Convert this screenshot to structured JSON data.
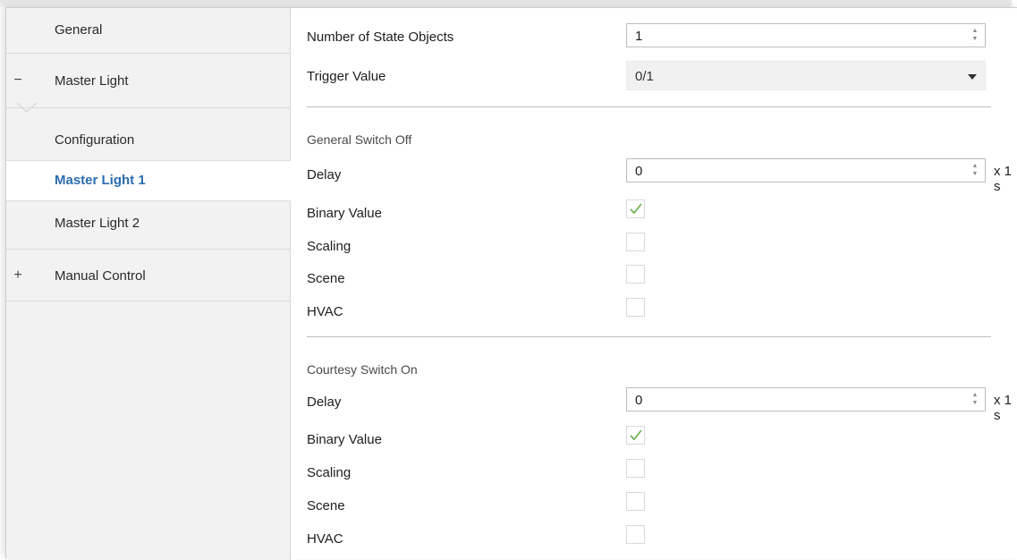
{
  "sidebar": {
    "items": [
      {
        "label": "General",
        "sign": ""
      },
      {
        "label": "Master Light",
        "sign": "−"
      },
      {
        "label": "Configuration",
        "sign": ""
      },
      {
        "label": "Master Light 1",
        "sign": "",
        "selected": true
      },
      {
        "label": "Master Light 2",
        "sign": ""
      },
      {
        "label": "Manual Control",
        "sign": "+"
      }
    ]
  },
  "main": {
    "number_of_state_objects": {
      "label": "Number of State Objects",
      "value": "1"
    },
    "trigger_value": {
      "label": "Trigger Value",
      "value": "0/1"
    },
    "general_switch_off": {
      "title": "General Switch Off",
      "delay": {
        "label": "Delay",
        "value": "0",
        "unit": "x 1 s"
      },
      "binary_value": {
        "label": "Binary Value",
        "checked": true
      },
      "scaling": {
        "label": "Scaling",
        "checked": false
      },
      "scene": {
        "label": "Scene",
        "checked": false
      },
      "hvac": {
        "label": "HVAC",
        "checked": false
      }
    },
    "courtesy_switch_on": {
      "title": "Courtesy Switch On",
      "delay": {
        "label": "Delay",
        "value": "0",
        "unit": "x 1 s"
      },
      "binary_value": {
        "label": "Binary Value",
        "checked": true
      },
      "scaling": {
        "label": "Scaling",
        "checked": false
      },
      "scene": {
        "label": "Scene",
        "checked": false
      },
      "hvac": {
        "label": "HVAC",
        "checked": false
      }
    }
  },
  "colors": {
    "selected_text": "#2b6cb0",
    "checkmark": "#6ab04c",
    "sidebar_bg": "#f2f2f2"
  }
}
